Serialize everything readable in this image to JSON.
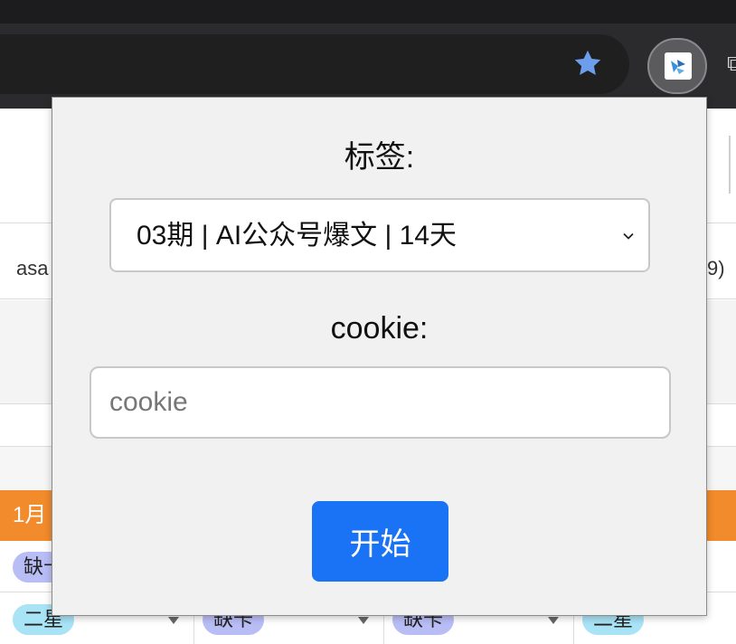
{
  "popup": {
    "tag_label": "标签:",
    "tag_select_value": "03期 | AI公众号爆文 | 14天",
    "cookie_label": "cookie:",
    "cookie_placeholder": "cookie",
    "cookie_value": "",
    "start_button_label": "开始"
  },
  "background_page": {
    "row_text_left": "asa",
    "row_text_right": "9)",
    "month_row_label": "1月",
    "pills": [
      "缺卡",
      "二星",
      "缺卡",
      "缺卡",
      "二星"
    ]
  },
  "colors": {
    "accent_button": "#1a73f5",
    "orange_row": "#f28b2c",
    "star_icon": "#6d9eeb"
  },
  "icons": {
    "bookmark": "star-icon",
    "extension": "extension-icon",
    "select": "chevron-down-icon"
  }
}
